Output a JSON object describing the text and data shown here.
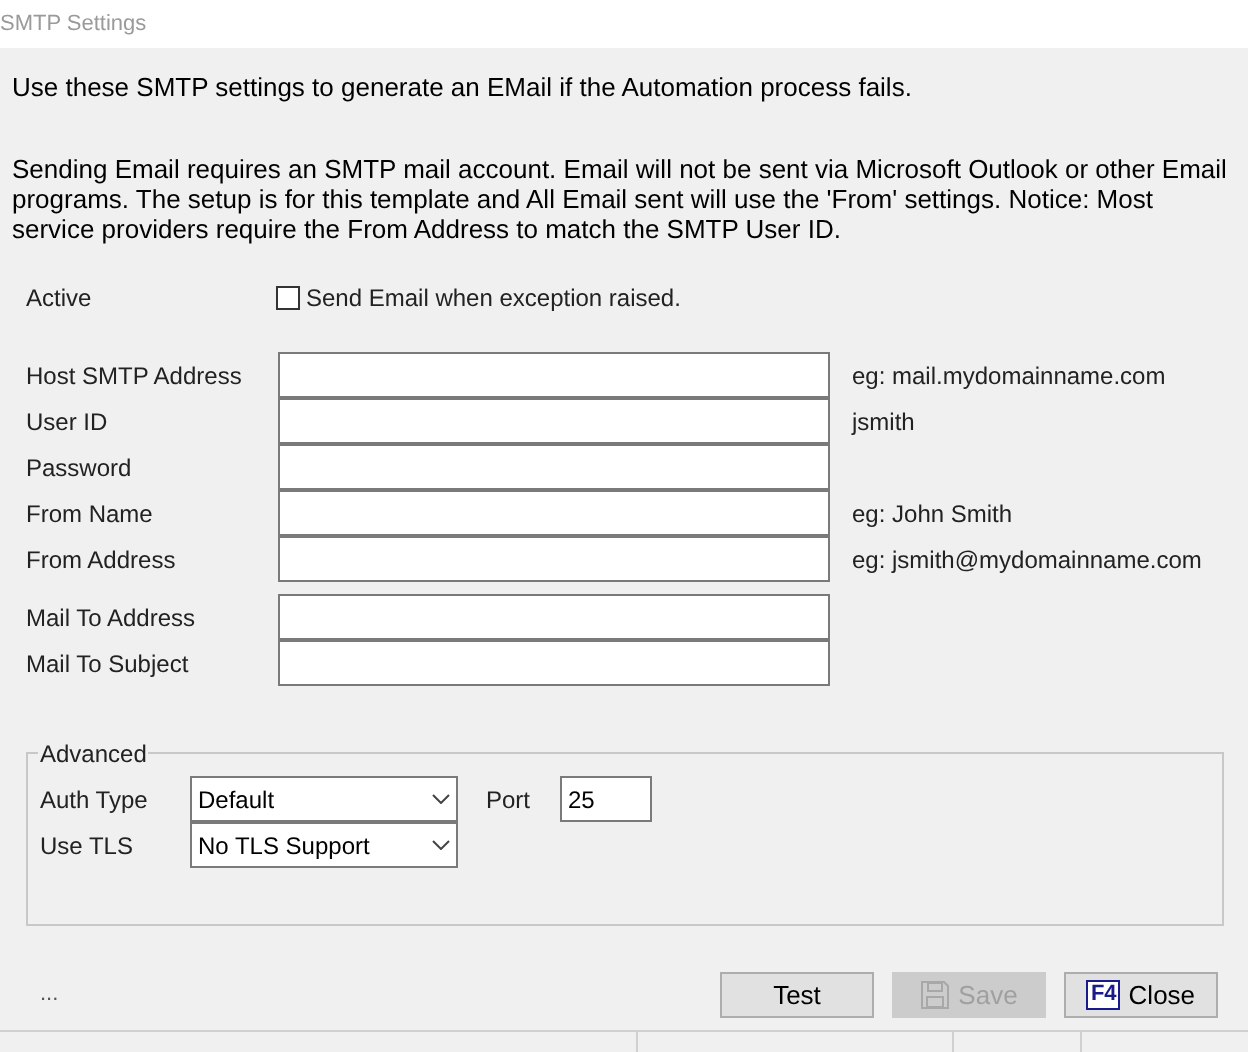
{
  "window": {
    "title": "SMTP Settings"
  },
  "intro": "Use these SMTP settings to generate an EMail if the Automation process fails.",
  "notice": "Sending Email requires an SMTP mail account. Email will not be sent via Microsoft Outlook or other Email programs. The setup is for this template and All Email sent will use the 'From' settings. Notice: Most service providers require the From Address to match the SMTP User ID.",
  "active": {
    "label": "Active",
    "checkbox": "Send Email when exception raised.",
    "checked": false
  },
  "fields": [
    {
      "label": "Host SMTP Address",
      "hint": "eg: mail.mydomainname.com"
    },
    {
      "label": "User ID",
      "hint": "jsmith"
    },
    {
      "label": "Password"
    },
    {
      "label": "From Name",
      "hint": "eg: John Smith"
    },
    {
      "label": "From Address",
      "hint": "eg: jsmith@mydomainname.com"
    }
  ],
  "mail_fields": [
    {
      "label": "Mail To Address"
    },
    {
      "label": "Mail To Subject"
    }
  ],
  "advanced": {
    "title": "Advanced",
    "auth_type": {
      "label": "Auth Type",
      "value": "Default"
    },
    "port": {
      "label": "Port",
      "value": "25"
    },
    "use_tls": {
      "label": "Use TLS",
      "value": "No TLS Support"
    }
  },
  "status_text": "...",
  "buttons": [
    {
      "kind": "plain",
      "label": "Test",
      "disabled": false
    },
    {
      "kind": "save",
      "label": "Save",
      "disabled": true
    },
    {
      "kind": "key",
      "key": "F4",
      "label": "Close",
      "disabled": false
    }
  ]
}
